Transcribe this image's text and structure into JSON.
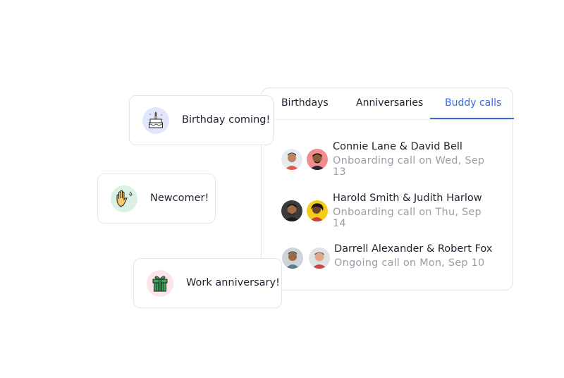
{
  "tabs": [
    {
      "label": "Birthdays"
    },
    {
      "label": "Anniversaries"
    },
    {
      "label": "Buddy calls",
      "active": true
    }
  ],
  "calls": [
    {
      "names": "Connie Lane  & David Bell",
      "status": "Onboarding call on Wed, Sep 13"
    },
    {
      "names": "Harold Smith & Judith Harlow",
      "status": "Onboarding call on Thu, Sep 14"
    },
    {
      "names": "Darrell Alexander & Robert Fox",
      "status": "Ongoing call on Mon, Sep 10"
    }
  ],
  "cards": [
    {
      "label": "Birthday coming!",
      "icon": "birthday-cake-icon"
    },
    {
      "label": "Newcomer!",
      "icon": "waving-hands-icon"
    },
    {
      "label": "Work anniversary!",
      "icon": "gift-box-icon"
    }
  ],
  "colors": {
    "accent": "#3a67e6",
    "muted": "#9a9ea8",
    "text": "#1f2330"
  }
}
